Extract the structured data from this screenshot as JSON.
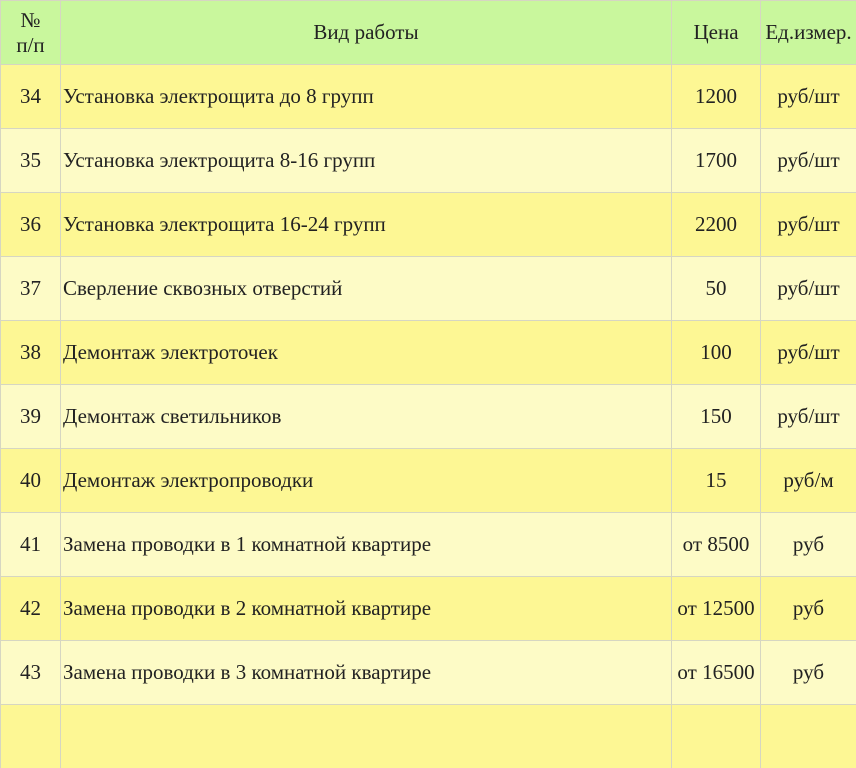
{
  "header": {
    "num_line1": "№",
    "num_line2": "п/п",
    "name": "Вид работы",
    "price": "Цена",
    "unit": "Ед.измер."
  },
  "rows": [
    {
      "num": "34",
      "name": "Установка электрощита до 8 групп",
      "price": "1200",
      "unit": "руб/шт"
    },
    {
      "num": "35",
      "name": "Установка электрощита 8-16 групп",
      "price": "1700",
      "unit": "руб/шт"
    },
    {
      "num": "36",
      "name": "Установка электрощита 16-24 групп",
      "price": "2200",
      "unit": "руб/шт"
    },
    {
      "num": "37",
      "name": "Сверление сквозных отверстий",
      "price": "50",
      "unit": "руб/шт"
    },
    {
      "num": "38",
      "name": "Демонтаж электроточек",
      "price": "100",
      "unit": "руб/шт"
    },
    {
      "num": "39",
      "name": "Демонтаж светильников",
      "price": "150",
      "unit": "руб/шт"
    },
    {
      "num": "40",
      "name": "Демонтаж электропроводки",
      "price": "15",
      "unit": "руб/м"
    },
    {
      "num": "41",
      "name": "Замена проводки в 1 комнатной квартире",
      "price": "от 8500",
      "unit": "руб"
    },
    {
      "num": "42",
      "name": "Замена проводки в 2 комнатной квартире",
      "price": "от 12500",
      "unit": "руб"
    },
    {
      "num": "43",
      "name": "Замена проводки в 3 комнатной квартире",
      "price": "от 16500",
      "unit": "руб"
    }
  ],
  "colors": {
    "header_bg": "#c9f79d",
    "row_odd_bg": "#fdf794",
    "row_even_bg": "#fdfbc6",
    "grid_line": "#d6d6c2"
  }
}
